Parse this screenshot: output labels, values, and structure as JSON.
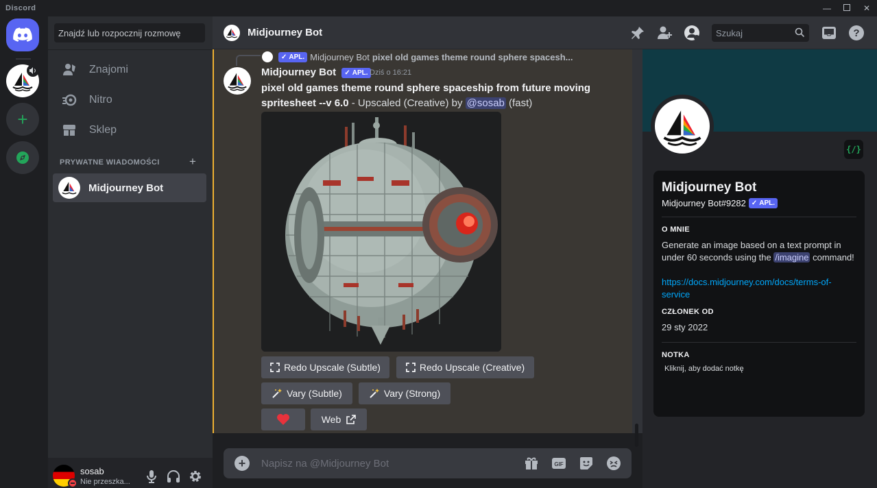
{
  "window": {
    "app_name": "Discord"
  },
  "sidebar": {
    "search_placeholder": "Znajdź lub rozpocznij rozmowę",
    "nav": [
      {
        "label": "Znajomi",
        "icon": "friends-icon"
      },
      {
        "label": "Nitro",
        "icon": "nitro-icon"
      },
      {
        "label": "Sklep",
        "icon": "shop-icon"
      }
    ],
    "dm_header": "PRYWATNE WIADOMOŚCI",
    "dm_add": "+",
    "dm_active": "Midjourney Bot"
  },
  "user": {
    "name": "sosab",
    "status": "Nie przeszka..."
  },
  "header": {
    "title": "Midjourney Bot",
    "search_placeholder": "Szukaj"
  },
  "message": {
    "reply_badge": "APL.",
    "reply_author": "Midjourney Bot",
    "reply_text": "pixel old games theme round sphere spacesh...",
    "author": "Midjourney Bot",
    "badge": "APL.",
    "time": "Dziś o 16:21",
    "prompt": "pixel old games theme round sphere spaceship from future moving spritesheet --v 6.0",
    "suffix": " - Upscaled (Creative) by ",
    "mention": "@sosab",
    "speed": " (fast)",
    "image_alt": "pixel art spherical spaceship"
  },
  "buttons": {
    "redo_subtle": "Redo Upscale (Subtle)",
    "redo_creative": "Redo Upscale (Creative)",
    "vary_subtle": "Vary (Subtle)",
    "vary_strong": "Vary (Strong)",
    "web": "Web"
  },
  "composer": {
    "placeholder": "Napisz na @Midjourney Bot"
  },
  "profile": {
    "name": "Midjourney Bot",
    "tag": "Midjourney Bot#9282",
    "badge": "APL.",
    "code_badge": "{/}",
    "about_heading": "O MNIE",
    "about_pre": "Generate an image based on a text prompt in under 60 seconds using the ",
    "about_command": "/imagine",
    "about_post": " command!",
    "link": "https://docs.midjourney.com/docs/terms-of-service",
    "member_heading": "CZŁONEK OD",
    "member_since": "29 sty 2022",
    "note_heading": "NOTKA",
    "note_placeholder": "Kliknij, aby dodać notkę"
  },
  "colors": {
    "accent": "#5865f2",
    "highlight": "#f0b232",
    "link": "#00a8fc",
    "dnd": "#f23f43"
  }
}
